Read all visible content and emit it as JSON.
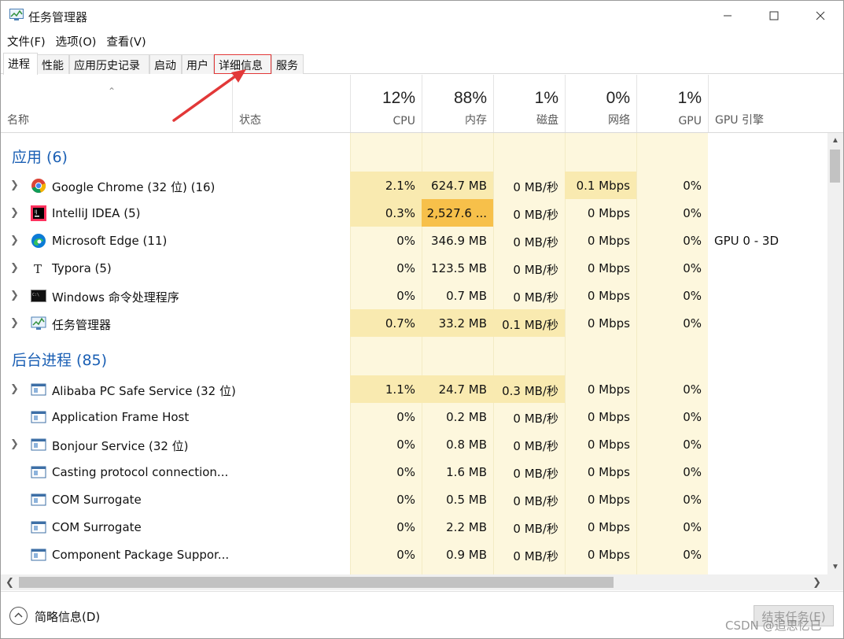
{
  "window": {
    "title": "任务管理器"
  },
  "menu": [
    "文件(F)",
    "选项(O)",
    "查看(V)"
  ],
  "tabs": [
    "进程",
    "性能",
    "应用历史记录",
    "启动",
    "用户",
    "详细信息",
    "服务"
  ],
  "active_tab": "进程",
  "highlighted_tab": "详细信息",
  "columns": {
    "name": "名称",
    "status": "状态",
    "cpu": {
      "pct": "12%",
      "label": "CPU"
    },
    "memory": {
      "pct": "88%",
      "label": "内存"
    },
    "disk": {
      "pct": "1%",
      "label": "磁盘"
    },
    "network": {
      "pct": "0%",
      "label": "网络"
    },
    "gpu": {
      "pct": "1%",
      "label": "GPU"
    },
    "gpu_engine": "GPU 引擎"
  },
  "groups": {
    "apps": {
      "title": "应用 (6)",
      "rows": [
        {
          "icon": "chrome-icon",
          "name": "Google Chrome (32 位) (16)",
          "cpu": "2.1%",
          "mem": "624.7 MB",
          "disk": "0 MB/秒",
          "net": "0.1 Mbps",
          "gpu": "0%",
          "gpu_engine": ""
        },
        {
          "icon": "intellij-icon",
          "name": "IntelliJ IDEA (5)",
          "cpu": "0.3%",
          "mem": "2,527.6 ...",
          "disk": "0 MB/秒",
          "net": "0 Mbps",
          "gpu": "0%",
          "gpu_engine": ""
        },
        {
          "icon": "edge-icon",
          "name": "Microsoft Edge (11)",
          "cpu": "0%",
          "mem": "346.9 MB",
          "disk": "0 MB/秒",
          "net": "0 Mbps",
          "gpu": "0%",
          "gpu_engine": "GPU 0 - 3D"
        },
        {
          "icon": "typora-icon",
          "name": "Typora (5)",
          "cpu": "0%",
          "mem": "123.5 MB",
          "disk": "0 MB/秒",
          "net": "0 Mbps",
          "gpu": "0%",
          "gpu_engine": ""
        },
        {
          "icon": "cmd-icon",
          "name": "Windows 命令处理程序",
          "cpu": "0%",
          "mem": "0.7 MB",
          "disk": "0 MB/秒",
          "net": "0 Mbps",
          "gpu": "0%",
          "gpu_engine": ""
        },
        {
          "icon": "taskmgr-icon",
          "name": "任务管理器",
          "cpu": "0.7%",
          "mem": "33.2 MB",
          "disk": "0.1 MB/秒",
          "net": "0 Mbps",
          "gpu": "0%",
          "gpu_engine": ""
        }
      ]
    },
    "background": {
      "title": "后台进程 (85)",
      "rows": [
        {
          "icon": "service-icon",
          "name": "Alibaba PC Safe Service (32 位)",
          "cpu": "1.1%",
          "mem": "24.7 MB",
          "disk": "0.3 MB/秒",
          "net": "0 Mbps",
          "gpu": "0%",
          "gpu_engine": ""
        },
        {
          "icon": "service-icon",
          "name": "Application Frame Host",
          "cpu": "0%",
          "mem": "0.2 MB",
          "disk": "0 MB/秒",
          "net": "0 Mbps",
          "gpu": "0%",
          "gpu_engine": ""
        },
        {
          "icon": "service-icon",
          "name": "Bonjour Service (32 位)",
          "cpu": "0%",
          "mem": "0.8 MB",
          "disk": "0 MB/秒",
          "net": "0 Mbps",
          "gpu": "0%",
          "gpu_engine": ""
        },
        {
          "icon": "service-icon",
          "name": "Casting protocol connection...",
          "cpu": "0%",
          "mem": "1.6 MB",
          "disk": "0 MB/秒",
          "net": "0 Mbps",
          "gpu": "0%",
          "gpu_engine": ""
        },
        {
          "icon": "service-icon",
          "name": "COM Surrogate",
          "cpu": "0%",
          "mem": "0.5 MB",
          "disk": "0 MB/秒",
          "net": "0 Mbps",
          "gpu": "0%",
          "gpu_engine": ""
        },
        {
          "icon": "service-icon",
          "name": "COM Surrogate",
          "cpu": "0%",
          "mem": "2.2 MB",
          "disk": "0 MB/秒",
          "net": "0 Mbps",
          "gpu": "0%",
          "gpu_engine": ""
        },
        {
          "icon": "service-icon",
          "name": "Component Package Suppor...",
          "cpu": "0%",
          "mem": "0.9 MB",
          "disk": "0 MB/秒",
          "net": "0 Mbps",
          "gpu": "0%",
          "gpu_engine": ""
        }
      ]
    }
  },
  "footer": {
    "fewer_details": "简略信息(D)",
    "end_task": "结束任务(E)"
  },
  "watermark": "CSDN @追思忆已",
  "colors": {
    "group_title": "#1a5fb4",
    "cell_shade": "#f9eab0",
    "cell_hot": "#f7c04a",
    "annotation": "#e23838"
  }
}
